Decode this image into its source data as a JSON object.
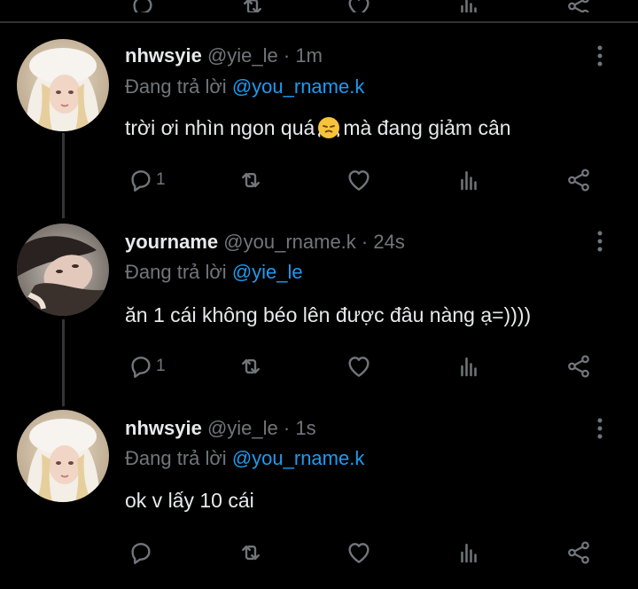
{
  "colors": {
    "background": "#000000",
    "text": "#e7e9ea",
    "muted": "#71767b",
    "link": "#1d9bf0",
    "divider": "#2f3336"
  },
  "icons": {
    "reply": "reply-icon",
    "retweet": "retweet-icon",
    "like": "heart-icon",
    "views": "views-icon",
    "share": "share-icon",
    "more": "more-vertical-icon"
  },
  "tweets": [
    {
      "name": "nhwsyie",
      "handle": "@yie_le",
      "sep": "·",
      "time": "1m",
      "reply_prefix": "Đang trả lời",
      "reply_to": "@you_rname.k",
      "text_before_emoji": "trời ơi nhìn ngon quá",
      "emoji": "face-with-steam-emoji",
      "text_after_emoji": "mà đang giảm cân",
      "reply_count": "1"
    },
    {
      "name": "yourname",
      "handle": "@you_rname.k",
      "sep": "·",
      "time": "24s",
      "reply_prefix": "Đang trả lời",
      "reply_to": "@yie_le",
      "text": "ăn 1 cái không béo lên được đâu nàng ạ=))))",
      "reply_count": "1"
    },
    {
      "name": "nhwsyie",
      "handle": "@yie_le",
      "sep": "·",
      "time": "1s",
      "reply_prefix": "Đang trả lời",
      "reply_to": "@you_rname.k",
      "text": "ok v lấy 10 cái",
      "reply_count": ""
    }
  ]
}
